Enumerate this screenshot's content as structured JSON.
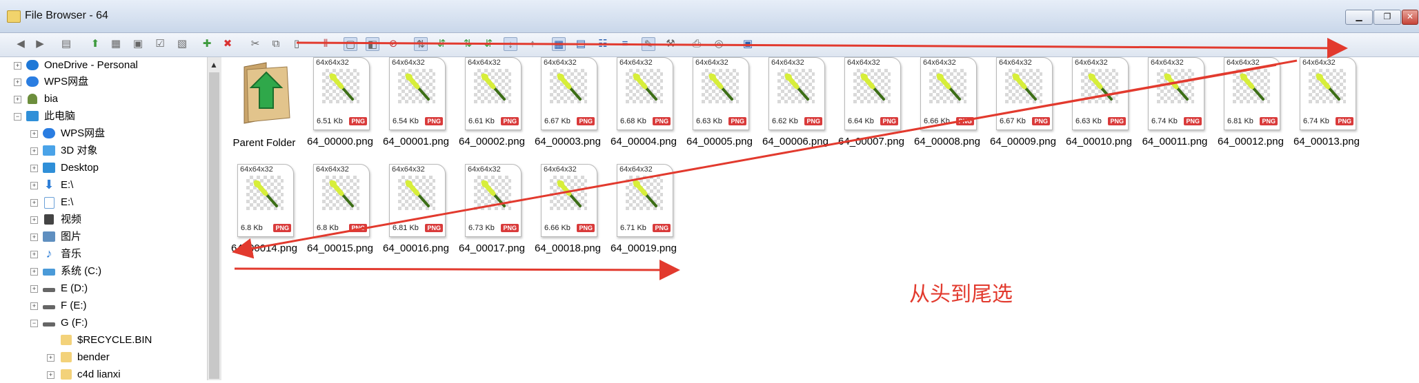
{
  "window": {
    "title": "File Browser - 64",
    "minimize_label": "▁",
    "maximize_label": "❐",
    "close_label": "✕"
  },
  "sidebar": {
    "items": [
      {
        "label": "OneDrive - Personal",
        "icon": "cloud-icon",
        "color": "#1e78d7"
      },
      {
        "label": "WPS网盘",
        "icon": "cloud-icon",
        "color": "#2a7de1"
      },
      {
        "label": "bia",
        "icon": "user-icon",
        "color": "#6c8e3c"
      },
      {
        "label": "此电脑",
        "icon": "computer-icon",
        "color": "#2f8fd8"
      },
      {
        "label": "WPS网盘",
        "icon": "cloud-icon",
        "color": "#2a7de1"
      },
      {
        "label": "3D 对象",
        "icon": "cube-icon",
        "color": "#4aa3e8"
      },
      {
        "label": "Desktop",
        "icon": "desktop-icon",
        "color": "#2f8fd8"
      },
      {
        "label": "E:\\",
        "icon": "download-icon",
        "color": "#2f7fd8"
      },
      {
        "label": "E:\\",
        "icon": "document-icon",
        "color": "#6aa0d8"
      },
      {
        "label": "视频",
        "icon": "film-icon",
        "color": "#444444"
      },
      {
        "label": "图片",
        "icon": "picture-icon",
        "color": "#5f8fc0"
      },
      {
        "label": "音乐",
        "icon": "music-icon",
        "color": "#2f7fd8"
      },
      {
        "label": "系统 (C:)",
        "icon": "drive-icon",
        "color": "#4a9ad8"
      },
      {
        "label": "E (D:)",
        "icon": "drive-icon",
        "color": "#666666"
      },
      {
        "label": "F (E:)",
        "icon": "drive-icon",
        "color": "#666666"
      },
      {
        "label": "G (F:)",
        "icon": "drive-icon",
        "color": "#666666"
      },
      {
        "label": "$RECYCLE.BIN",
        "icon": "folder-icon",
        "color": "#f3d27a"
      },
      {
        "label": "bender",
        "icon": "folder-icon",
        "color": "#f3d27a"
      },
      {
        "label": "c4d lianxi",
        "icon": "folder-icon",
        "color": "#f3d27a"
      }
    ]
  },
  "content": {
    "parent_folder_label": "Parent Folder",
    "files": [
      {
        "name": "64_00000.png",
        "dims": "64x64x32",
        "size": "6.51 Kb",
        "type": "PNG"
      },
      {
        "name": "64_00001.png",
        "dims": "64x64x32",
        "size": "6.54 Kb",
        "type": "PNG"
      },
      {
        "name": "64_00002.png",
        "dims": "64x64x32",
        "size": "6.61 Kb",
        "type": "PNG"
      },
      {
        "name": "64_00003.png",
        "dims": "64x64x32",
        "size": "6.67 Kb",
        "type": "PNG"
      },
      {
        "name": "64_00004.png",
        "dims": "64x64x32",
        "size": "6.68 Kb",
        "type": "PNG"
      },
      {
        "name": "64_00005.png",
        "dims": "64x64x32",
        "size": "6.63 Kb",
        "type": "PNG"
      },
      {
        "name": "64_00006.png",
        "dims": "64x64x32",
        "size": "6.62 Kb",
        "type": "PNG"
      },
      {
        "name": "64_00007.png",
        "dims": "64x64x32",
        "size": "6.64 Kb",
        "type": "PNG"
      },
      {
        "name": "64_00008.png",
        "dims": "64x64x32",
        "size": "6.66 Kb",
        "type": "PNG"
      },
      {
        "name": "64_00009.png",
        "dims": "64x64x32",
        "size": "6.67 Kb",
        "type": "PNG"
      },
      {
        "name": "64_00010.png",
        "dims": "64x64x32",
        "size": "6.63 Kb",
        "type": "PNG"
      },
      {
        "name": "64_00011.png",
        "dims": "64x64x32",
        "size": "6.74 Kb",
        "type": "PNG"
      },
      {
        "name": "64_00012.png",
        "dims": "64x64x32",
        "size": "6.81 Kb",
        "type": "PNG"
      },
      {
        "name": "64_00013.png",
        "dims": "64x64x32",
        "size": "6.74 Kb",
        "type": "PNG"
      },
      {
        "name": "64_00014.png",
        "dims": "64x64x32",
        "size": "6.8 Kb",
        "type": "PNG"
      },
      {
        "name": "64_00015.png",
        "dims": "64x64x32",
        "size": "6.8 Kb",
        "type": "PNG"
      },
      {
        "name": "64_00016.png",
        "dims": "64x64x32",
        "size": "6.81 Kb",
        "type": "PNG"
      },
      {
        "name": "64_00017.png",
        "dims": "64x64x32",
        "size": "6.73 Kb",
        "type": "PNG"
      },
      {
        "name": "64_00018.png",
        "dims": "64x64x32",
        "size": "6.66 Kb",
        "type": "PNG"
      },
      {
        "name": "64_00019.png",
        "dims": "64x64x32",
        "size": "6.71 Kb",
        "type": "PNG"
      }
    ]
  },
  "annotation": {
    "text": "从头到尾选",
    "color": "#e23a2e"
  },
  "colors": {
    "accent_red": "#e23a2e",
    "png_badge": "#d93b3b",
    "wand_yellow": "#d7ee3a",
    "wand_green": "#3c6e16"
  }
}
